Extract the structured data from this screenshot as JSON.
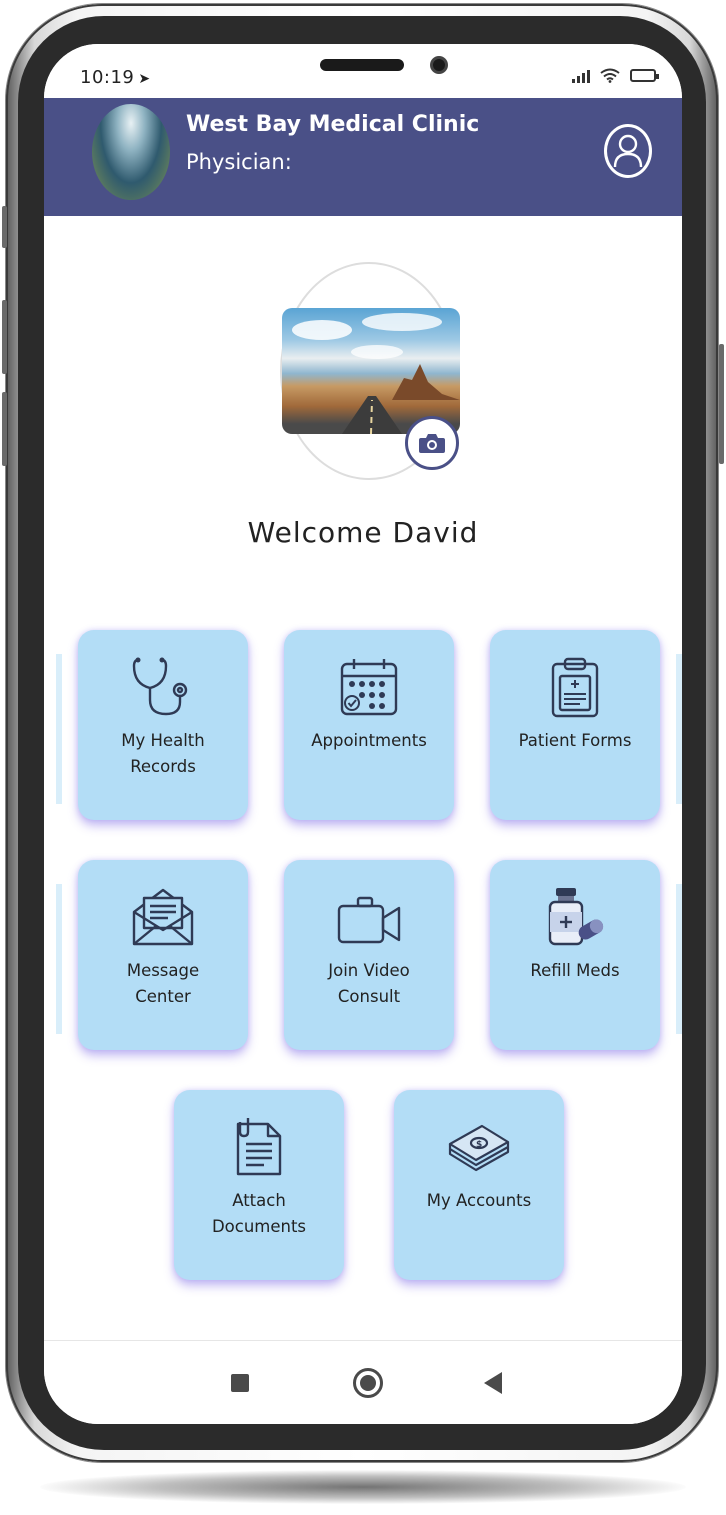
{
  "status_bar": {
    "time": "10:19",
    "location_arrow": "➤"
  },
  "header": {
    "clinic_name": "West Bay Medical Clinic",
    "physician_label": "Physician:",
    "accent_color": "#4a5087"
  },
  "profile": {
    "welcome": "Welcome David"
  },
  "tiles": [
    {
      "label": "My Health\nRecords",
      "icon": "stethoscope-icon"
    },
    {
      "label": "Appointments",
      "icon": "calendar-icon"
    },
    {
      "label": "Patient Forms",
      "icon": "clipboard-icon"
    },
    {
      "label": "Message\nCenter",
      "icon": "envelope-icon"
    },
    {
      "label": "Join Video\nConsult",
      "icon": "video-camera-icon"
    },
    {
      "label": "Refill Meds",
      "icon": "medicine-bottle-icon"
    },
    {
      "label": "Attach\nDocuments",
      "icon": "document-icon"
    },
    {
      "label": "My Accounts",
      "icon": "money-stack-icon"
    }
  ],
  "tile_color": "#b3ddf6",
  "nav": {
    "recent": "square",
    "home": "circle",
    "back": "triangle"
  }
}
